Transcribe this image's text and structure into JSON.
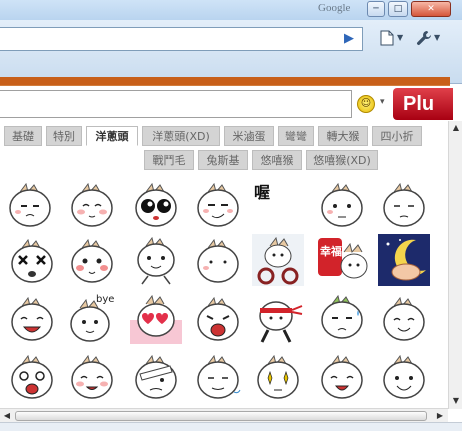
{
  "window": {
    "brand": "Google",
    "minimize_glyph": "─",
    "maximize_glyph": "□",
    "close_glyph": "✕"
  },
  "toolbar": {
    "go_glyph": "▶",
    "page_menu_icon": "page-icon",
    "tools_menu_icon": "wrench-icon"
  },
  "banner": {
    "plurk_label": "Plu",
    "emoticon_caret": "▾"
  },
  "tabs": [
    {
      "label": "基礎"
    },
    {
      "label": "特別"
    },
    {
      "label": "洋蔥頭",
      "active": true
    },
    {
      "label": "洋蔥頭(XD)"
    },
    {
      "label": "米滷蛋"
    },
    {
      "label": "彎彎"
    },
    {
      "label": "轉大猴"
    },
    {
      "label": "四小折"
    },
    {
      "label": "戰鬥毛"
    },
    {
      "label": "兔斯基"
    },
    {
      "label": "悠嘻猴"
    },
    {
      "label": "悠嘻猴(XD)"
    }
  ],
  "emoticons": {
    "row1_text": "喔",
    "bye_text": "bye",
    "fortune_text": "幸福",
    "items": [
      "onion-head-hmph",
      "onion-head-shy",
      "onion-head-big-eyes",
      "onion-head-smirk",
      "onion-text-oh",
      "onion-head-thinking",
      "onion-head-bored",
      "onion-head-dizzy",
      "onion-head-blush",
      "onion-head-dance",
      "onion-head-blank",
      "onion-head-bike",
      "onion-head-fortune",
      "onion-head-moon-sleep",
      "onion-head-laugh",
      "onion-head-bye",
      "onion-head-hearts",
      "onion-head-shout",
      "onion-head-ninja",
      "onion-head-sweat",
      "onion-head-wave",
      "onion-head-cry",
      "onion-head-giggle",
      "onion-head-injured",
      "onion-head-sly",
      "onion-head-sparkle",
      "onion-head-cheer",
      "onion-head-grin"
    ]
  },
  "colors": {
    "accent_orange": "#c8601a",
    "plurk_red": "#c0101e",
    "tab_inactive": "#d4d4d4"
  }
}
